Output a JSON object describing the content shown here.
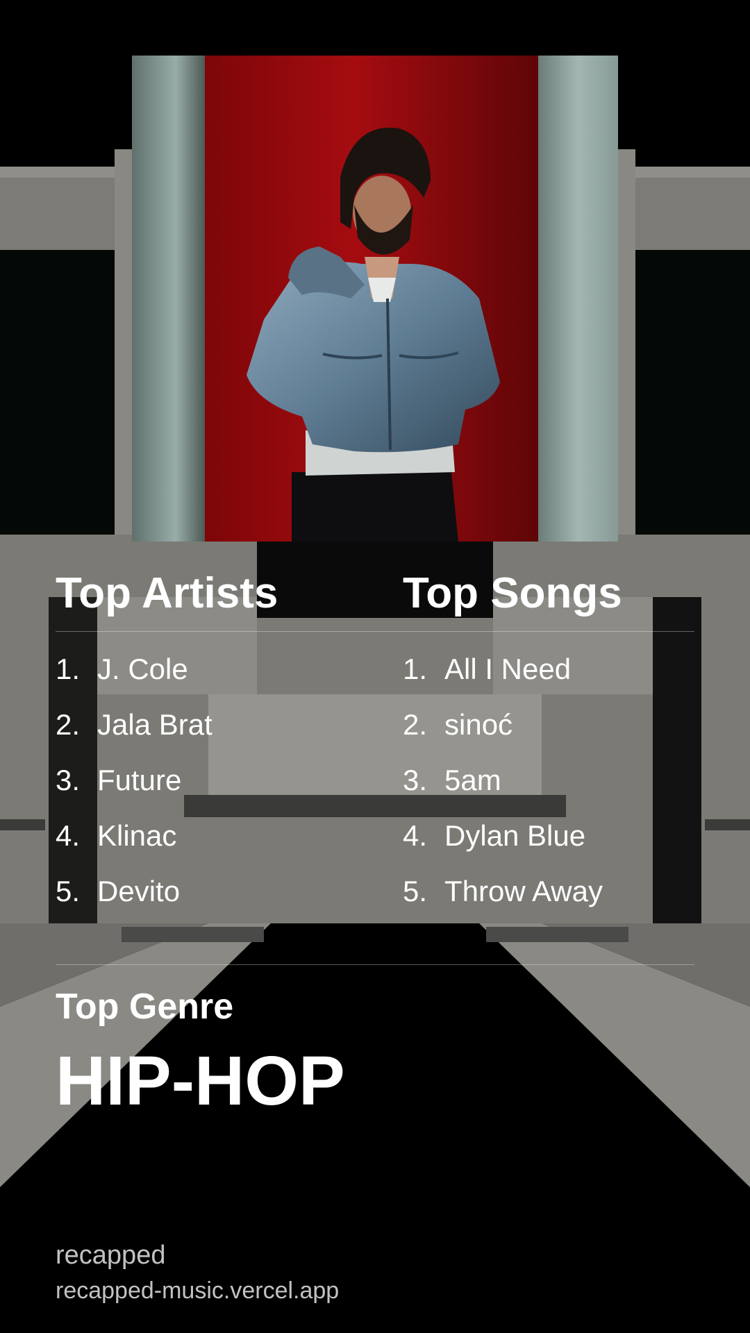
{
  "colors": {
    "background": "#000000",
    "text": "#ffffff",
    "muted_text": "#c2c2c2",
    "cover_red": "#8e0a0c",
    "cover_wall": "#8fa3a0"
  },
  "cover": {
    "alt_icon": "album-cover-image"
  },
  "top_artists": {
    "title": "Top Artists",
    "items": [
      {
        "rank": "1.",
        "name": "J. Cole"
      },
      {
        "rank": "2.",
        "name": "Jala Brat"
      },
      {
        "rank": "3.",
        "name": "Future"
      },
      {
        "rank": "4.",
        "name": "Klinac"
      },
      {
        "rank": "5.",
        "name": "Devito"
      }
    ]
  },
  "top_songs": {
    "title": "Top Songs",
    "items": [
      {
        "rank": "1.",
        "name": "All I Need"
      },
      {
        "rank": "2.",
        "name": "sinoć"
      },
      {
        "rank": "3.",
        "name": "5am"
      },
      {
        "rank": "4.",
        "name": "Dylan Blue"
      },
      {
        "rank": "5.",
        "name": "Throw Away"
      }
    ]
  },
  "top_genre": {
    "label": "Top Genre",
    "value": "HIP-HOP"
  },
  "footer": {
    "brand": "recapped",
    "url": "recapped-music.vercel.app"
  }
}
